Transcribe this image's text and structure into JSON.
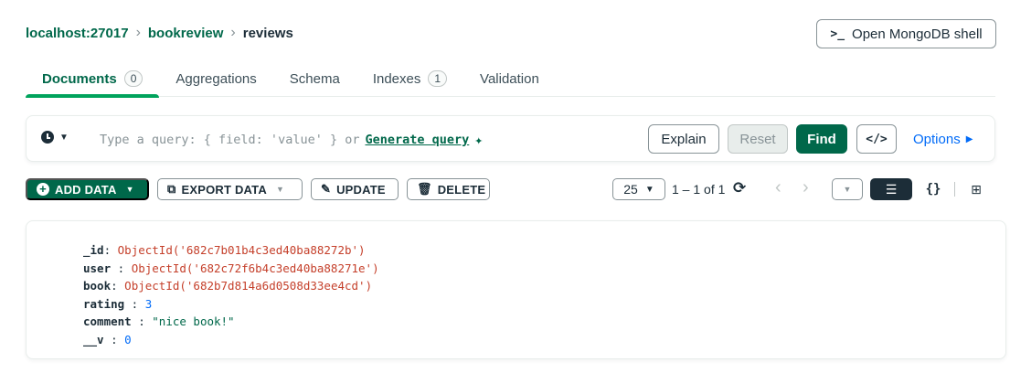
{
  "breadcrumb": {
    "host": "localhost:27017",
    "database": "bookreview",
    "collection": "reviews"
  },
  "shell_button": {
    "prompt": ">_",
    "label": "Open MongoDB shell"
  },
  "tabs": [
    {
      "label": "Documents",
      "count": "0"
    },
    {
      "label": "Aggregations"
    },
    {
      "label": "Schema"
    },
    {
      "label": "Indexes",
      "count": "1"
    },
    {
      "label": "Validation"
    }
  ],
  "query_bar": {
    "placeholder": "Type a query: { field: 'value' } or",
    "generate_link": "Generate query",
    "sparkle": "✦",
    "explain": "Explain",
    "reset": "Reset",
    "find": "Find",
    "code_toggle": "</>",
    "options": "Options"
  },
  "toolbar": {
    "add_data": "ADD DATA",
    "export_data": "EXPORT DATA",
    "update": "UPDATE",
    "delete": "DELETE",
    "page_size": "25",
    "range": "1 – 1 of 1"
  },
  "document": {
    "id_key": "_id",
    "id_value": "ObjectId('682c7b01b4c3ed40ba88272b')",
    "user_key": "user",
    "user_value": "ObjectId('682c72f6b4c3ed40ba88271e')",
    "book_key": "book",
    "book_value": "ObjectId('682b7d814a6d0508d33ee4cd')",
    "rating_key": "rating",
    "rating_value": "3",
    "comment_key": "comment",
    "comment_value": "\"nice book!\"",
    "v_key": "__v",
    "v_value": "0"
  },
  "colors": {
    "brand_green": "#00684a",
    "accent_green": "#00a35c",
    "link_blue": "#016bf8",
    "objectid_red": "#c5402b"
  },
  "icons": [
    "clock-icon",
    "sparkle-icon",
    "plus-circle-icon",
    "export-icon",
    "pencil-icon",
    "trash-icon",
    "refresh-icon",
    "chevron-left-icon",
    "chevron-right-icon",
    "list-view-icon",
    "json-view-icon",
    "table-view-icon"
  ]
}
